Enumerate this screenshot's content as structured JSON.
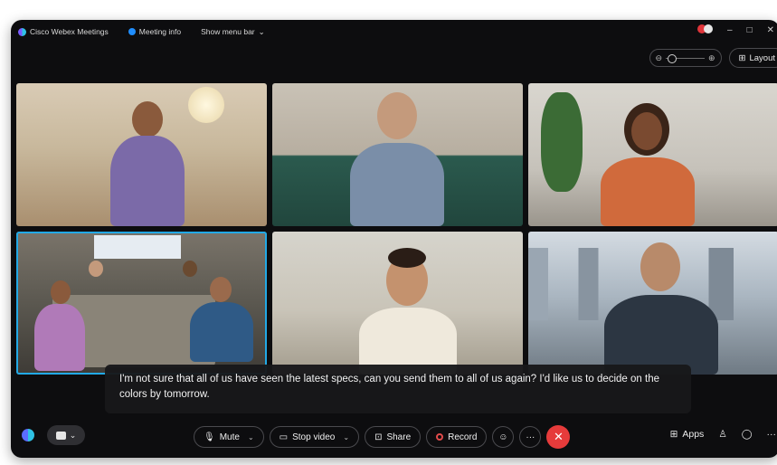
{
  "titlebar": {
    "app_name": "Cisco Webex Meetings",
    "meeting_info": "Meeting info",
    "show_menu_bar": "Show menu bar",
    "show_menu_chevron": "⌄",
    "minimize": "–",
    "maximize": "□",
    "close": "✕"
  },
  "toolbar_top": {
    "zoom_out": "⊖",
    "zoom_in": "⊕",
    "layout_label": "Layout",
    "layout_icon": "⊞"
  },
  "participants": [
    {
      "id": "p1",
      "shirt": "#7b6aa8",
      "skin": "#8a5a3c"
    },
    {
      "id": "p2",
      "shirt": "#7a8ea8",
      "skin": "#c49a7c"
    },
    {
      "id": "p3",
      "shirt": "#d06a3c",
      "skin": "#7a4a30"
    },
    {
      "id": "p4",
      "shirt": "#2f5a86",
      "skin": "#9a6a4c"
    },
    {
      "id": "p5",
      "shirt": "#efe9dc",
      "skin": "#c4926e"
    },
    {
      "id": "p6",
      "shirt": "#2c3642",
      "skin": "#b88a6a"
    }
  ],
  "caption": {
    "text": "I'm not sure that all of us have seen the latest specs, can you send them to all of us again? I'd like us to decide on the colors by tomorrow."
  },
  "bottom": {
    "mute": "Mute",
    "stop_video": "Stop video",
    "share": "Share",
    "record": "Record",
    "reactions_icon": "☺",
    "more_icon": "···",
    "end_icon": "✕",
    "apps": "Apps",
    "participants_icon": "♙",
    "chat_icon": "◯",
    "overflow_icon": "···",
    "chevron": "⌄"
  },
  "colors": {
    "accent": "#22a9e6",
    "end_call": "#e63b3b",
    "record": "#e24b4b",
    "background": "#0d0d0f"
  }
}
